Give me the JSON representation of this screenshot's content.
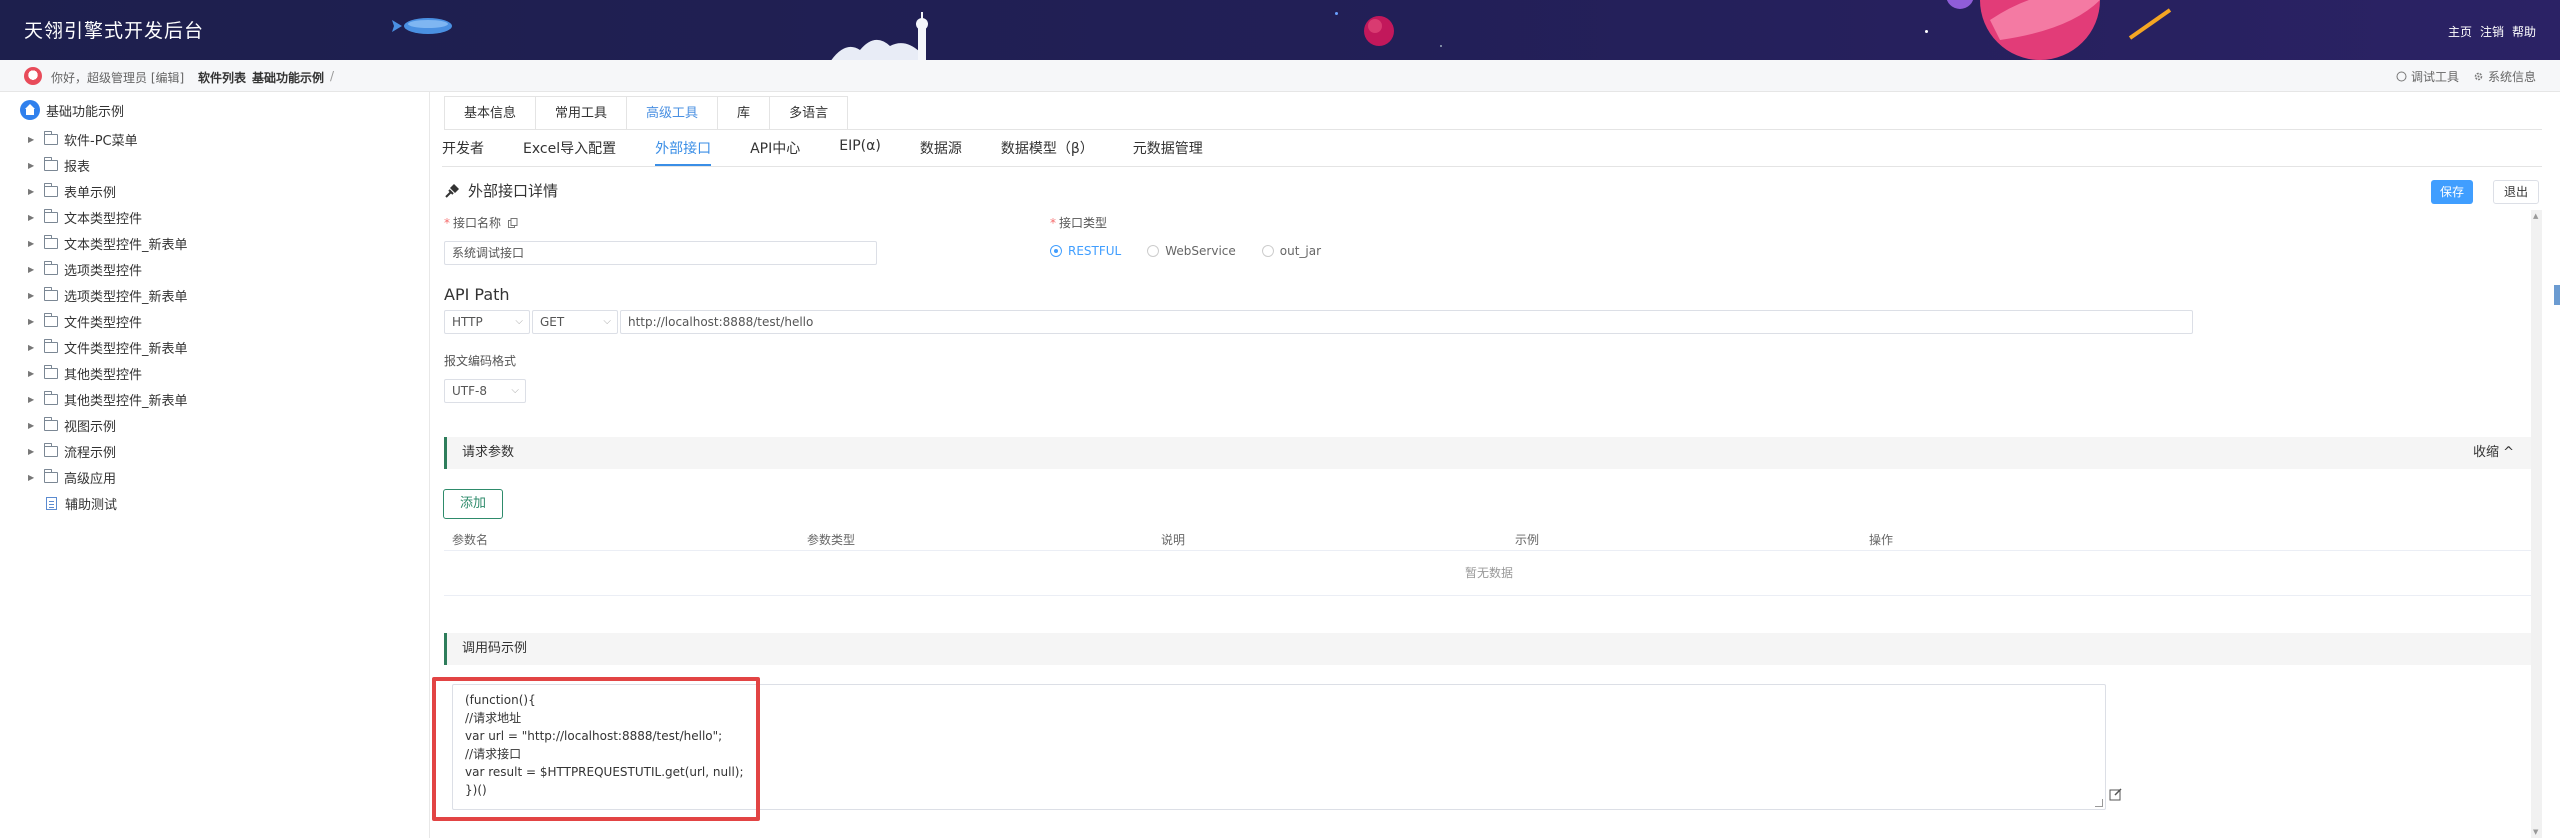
{
  "header": {
    "app_title": "天翎引擎式开发后台",
    "links": [
      "主页",
      "注销",
      "帮助"
    ]
  },
  "crumbbar": {
    "greeting": "你好，超级管理员 [编辑]",
    "crumbs": [
      "软件列表",
      "基础功能示例"
    ],
    "separator": "/",
    "tools": [
      "调试工具",
      "系统信息"
    ]
  },
  "sidebar": {
    "root": "基础功能示例",
    "items": [
      {
        "label": "软件-PC菜单",
        "type": "folder"
      },
      {
        "label": "报表",
        "type": "folder"
      },
      {
        "label": "表单示例",
        "type": "folder"
      },
      {
        "label": "文本类型控件",
        "type": "folder"
      },
      {
        "label": "文本类型控件_新表单",
        "type": "folder"
      },
      {
        "label": "选项类型控件",
        "type": "folder"
      },
      {
        "label": "选项类型控件_新表单",
        "type": "folder"
      },
      {
        "label": "文件类型控件",
        "type": "folder"
      },
      {
        "label": "文件类型控件_新表单",
        "type": "folder"
      },
      {
        "label": "其他类型控件",
        "type": "folder"
      },
      {
        "label": "其他类型控件_新表单",
        "type": "folder"
      },
      {
        "label": "视图示例",
        "type": "folder"
      },
      {
        "label": "流程示例",
        "type": "folder"
      },
      {
        "label": "高级应用",
        "type": "folder"
      },
      {
        "label": "辅助测试",
        "type": "doc"
      }
    ]
  },
  "tabs1": [
    {
      "label": "基本信息",
      "active": false
    },
    {
      "label": "常用工具",
      "active": false
    },
    {
      "label": "高级工具",
      "active": true
    },
    {
      "label": "库",
      "active": false
    },
    {
      "label": "多语言",
      "active": false
    }
  ],
  "tabs2": [
    {
      "label": "开发者",
      "active": false
    },
    {
      "label": "Excel导入配置",
      "active": false
    },
    {
      "label": "外部接口",
      "active": true
    },
    {
      "label": "API中心",
      "active": false
    },
    {
      "label": "EIP(α)",
      "active": false
    },
    {
      "label": "数据源",
      "active": false
    },
    {
      "label": "数据模型（β）",
      "active": false
    },
    {
      "label": "元数据管理",
      "active": false
    }
  ],
  "detail": {
    "title": "外部接口详情",
    "save": "保存",
    "exit": "退出"
  },
  "form": {
    "name_label": "接口名称",
    "name_value": "系统调试接口",
    "type_label": "接口类型",
    "type_options": [
      {
        "label": "RESTFUL",
        "checked": true
      },
      {
        "label": "WebService",
        "checked": false
      },
      {
        "label": "out_jar",
        "checked": false
      }
    ],
    "api_path_label": "API Path",
    "protocol": "HTTP",
    "method": "GET",
    "url": "http://localhost:8888/test/hello",
    "encoding_label": "报文编码格式",
    "encoding": "UTF-8"
  },
  "params": {
    "title": "请求参数",
    "collapse": "收缩",
    "add": "添加",
    "columns": [
      "参数名",
      "参数类型",
      "说明",
      "示例",
      "操作"
    ],
    "empty": "暂无数据"
  },
  "code": {
    "title": "调用码示例",
    "text": "(function(){\n//请求地址\nvar url = \"http://localhost:8888/test/hello\";\n//请求接口\nvar result = $HTTPREQUESTUTIL.get(url, null);\n})()"
  },
  "colors": {
    "primary": "#409eff",
    "accent_green": "#2e7d5b",
    "highlight_red": "#e24444",
    "header_bg": "#1d1f4d"
  }
}
